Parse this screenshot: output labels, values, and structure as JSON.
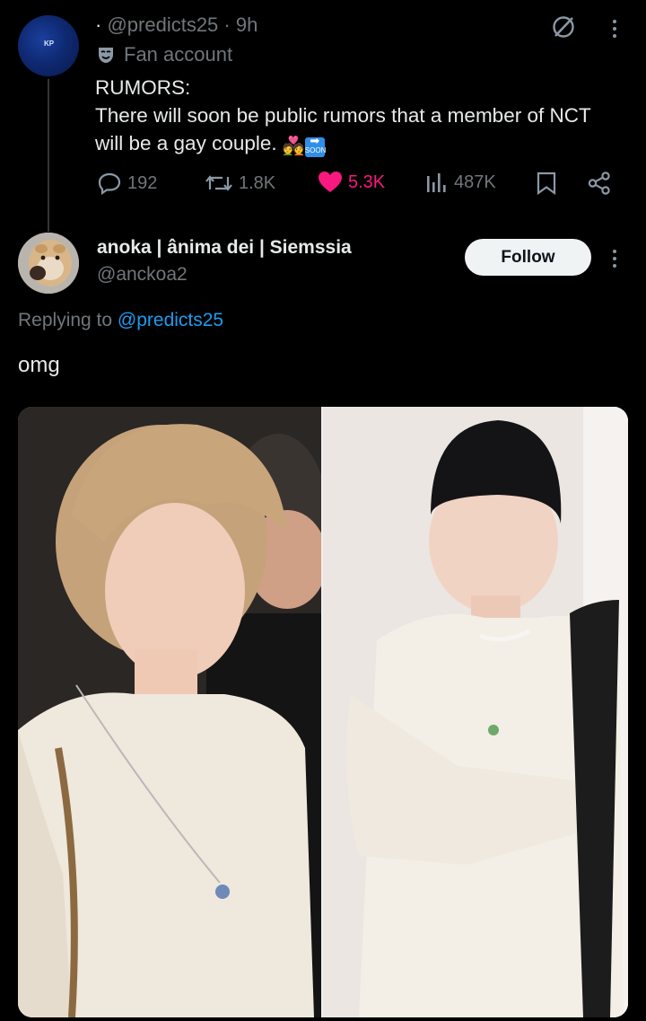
{
  "post": {
    "avatar_label": "KP",
    "handle": "@predicts25",
    "time": "9h",
    "bullet": "·",
    "badge_label": "Fan account",
    "text_lines": [
      "RUMORS:",
      "There will soon be public rumors that a member of NCT",
      "will be a gay couple."
    ],
    "soon_label": "SOON",
    "stats": {
      "replies": "192",
      "reposts": "1.8K",
      "likes": "5.3K",
      "views": "487K"
    },
    "colors": {
      "like": "#f91880",
      "muted": "#71767b"
    }
  },
  "reply": {
    "display_name": "anoka | ânima dei | Siemssia",
    "handle": "@anckoa2",
    "follow_label": "Follow",
    "replying_prefix": "Replying to",
    "replying_to": "@predicts25",
    "text": "omg",
    "colors": {
      "link": "#1d9bf0"
    }
  },
  "icons": {
    "badge": "mask-icon",
    "grok": "grok-icon",
    "more": "more-vertical-icon",
    "reply": "reply-icon",
    "repost": "repost-icon",
    "like": "heart-icon",
    "views": "views-icon",
    "bookmark": "bookmark-icon",
    "share": "share-icon"
  }
}
